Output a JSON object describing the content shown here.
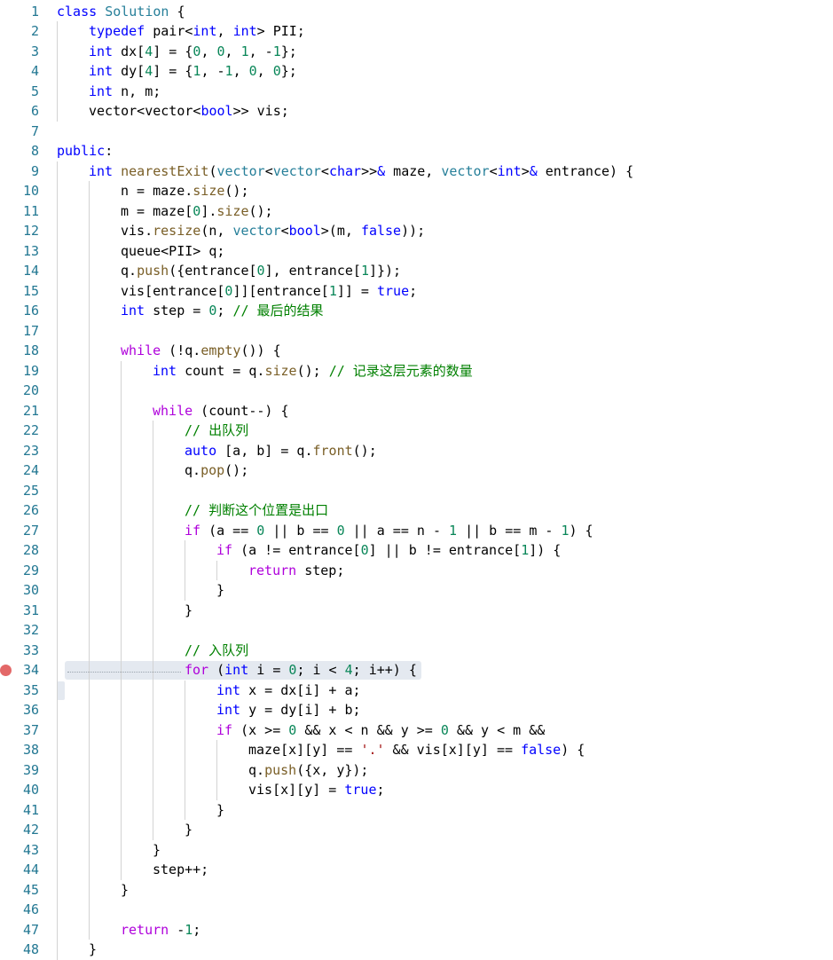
{
  "colors": {
    "keyword": "#0000ff",
    "type": "#267f99",
    "function": "#795e26",
    "control": "#af00db",
    "number": "#098658",
    "string": "#a31515",
    "comment": "#008000",
    "plain": "#000000",
    "line_number": "#237893",
    "breakpoint": "#e36868"
  },
  "editor": {
    "breakpoint_line": 34,
    "lines": [
      {
        "n": "1",
        "indent": 0,
        "tokens": [
          {
            "t": "class",
            "c": "keyword"
          },
          {
            "t": " "
          },
          {
            "t": "Solution",
            "c": "type"
          },
          {
            "t": " {"
          }
        ]
      },
      {
        "n": "2",
        "indent": 1,
        "tokens": [
          {
            "t": "typedef",
            "c": "keyword"
          },
          {
            "t": " pair<"
          },
          {
            "t": "int",
            "c": "keyword"
          },
          {
            "t": ", "
          },
          {
            "t": "int",
            "c": "keyword"
          },
          {
            "t": "> PII;"
          }
        ]
      },
      {
        "n": "3",
        "indent": 1,
        "tokens": [
          {
            "t": "int",
            "c": "keyword"
          },
          {
            "t": " dx["
          },
          {
            "t": "4",
            "c": "number"
          },
          {
            "t": "] = {"
          },
          {
            "t": "0",
            "c": "number"
          },
          {
            "t": ", "
          },
          {
            "t": "0",
            "c": "number"
          },
          {
            "t": ", "
          },
          {
            "t": "1",
            "c": "number"
          },
          {
            "t": ", -"
          },
          {
            "t": "1",
            "c": "number"
          },
          {
            "t": "};"
          }
        ]
      },
      {
        "n": "4",
        "indent": 1,
        "tokens": [
          {
            "t": "int",
            "c": "keyword"
          },
          {
            "t": " dy["
          },
          {
            "t": "4",
            "c": "number"
          },
          {
            "t": "] = {"
          },
          {
            "t": "1",
            "c": "number"
          },
          {
            "t": ", -"
          },
          {
            "t": "1",
            "c": "number"
          },
          {
            "t": ", "
          },
          {
            "t": "0",
            "c": "number"
          },
          {
            "t": ", "
          },
          {
            "t": "0",
            "c": "number"
          },
          {
            "t": "};"
          }
        ]
      },
      {
        "n": "5",
        "indent": 1,
        "tokens": [
          {
            "t": "int",
            "c": "keyword"
          },
          {
            "t": " n, m;"
          }
        ]
      },
      {
        "n": "6",
        "indent": 1,
        "tokens": [
          {
            "t": "vector<vector<"
          },
          {
            "t": "bool",
            "c": "keyword"
          },
          {
            "t": ">> vis;"
          }
        ]
      },
      {
        "n": "7",
        "indent": 0,
        "tokens": []
      },
      {
        "n": "8",
        "indent": 0,
        "tokens": [
          {
            "t": "public",
            "c": "keyword"
          },
          {
            "t": ":"
          }
        ]
      },
      {
        "n": "9",
        "indent": 1,
        "tokens": [
          {
            "t": "int",
            "c": "keyword"
          },
          {
            "t": " "
          },
          {
            "t": "nearestExit",
            "c": "function"
          },
          {
            "t": "("
          },
          {
            "t": "vector",
            "c": "type"
          },
          {
            "t": "<"
          },
          {
            "t": "vector",
            "c": "type"
          },
          {
            "t": "<"
          },
          {
            "t": "char",
            "c": "keyword"
          },
          {
            "t": ">>"
          },
          {
            "t": "&",
            "c": "keyword"
          },
          {
            "t": " maze, "
          },
          {
            "t": "vector",
            "c": "type"
          },
          {
            "t": "<"
          },
          {
            "t": "int",
            "c": "keyword"
          },
          {
            "t": ">"
          },
          {
            "t": "&",
            "c": "keyword"
          },
          {
            "t": " entrance) {"
          }
        ]
      },
      {
        "n": "10",
        "indent": 2,
        "tokens": [
          {
            "t": "n = maze."
          },
          {
            "t": "size",
            "c": "function"
          },
          {
            "t": "();"
          }
        ]
      },
      {
        "n": "11",
        "indent": 2,
        "tokens": [
          {
            "t": "m = maze["
          },
          {
            "t": "0",
            "c": "number"
          },
          {
            "t": "]."
          },
          {
            "t": "size",
            "c": "function"
          },
          {
            "t": "();"
          }
        ]
      },
      {
        "n": "12",
        "indent": 2,
        "tokens": [
          {
            "t": "vis."
          },
          {
            "t": "resize",
            "c": "function"
          },
          {
            "t": "(n, "
          },
          {
            "t": "vector",
            "c": "type"
          },
          {
            "t": "<"
          },
          {
            "t": "bool",
            "c": "keyword"
          },
          {
            "t": ">(m, "
          },
          {
            "t": "false",
            "c": "keyword"
          },
          {
            "t": "));"
          }
        ]
      },
      {
        "n": "13",
        "indent": 2,
        "tokens": [
          {
            "t": "queue<PII> q;"
          }
        ]
      },
      {
        "n": "14",
        "indent": 2,
        "tokens": [
          {
            "t": "q."
          },
          {
            "t": "push",
            "c": "function"
          },
          {
            "t": "({entrance["
          },
          {
            "t": "0",
            "c": "number"
          },
          {
            "t": "], entrance["
          },
          {
            "t": "1",
            "c": "number"
          },
          {
            "t": "]});"
          }
        ]
      },
      {
        "n": "15",
        "indent": 2,
        "tokens": [
          {
            "t": "vis[entrance["
          },
          {
            "t": "0",
            "c": "number"
          },
          {
            "t": "]][entrance["
          },
          {
            "t": "1",
            "c": "number"
          },
          {
            "t": "]] = "
          },
          {
            "t": "true",
            "c": "keyword"
          },
          {
            "t": ";"
          }
        ]
      },
      {
        "n": "16",
        "indent": 2,
        "tokens": [
          {
            "t": "int",
            "c": "keyword"
          },
          {
            "t": " step = "
          },
          {
            "t": "0",
            "c": "number"
          },
          {
            "t": "; "
          },
          {
            "t": "// 最后的结果",
            "c": "comment"
          }
        ]
      },
      {
        "n": "17",
        "indent": 0,
        "tokens": []
      },
      {
        "n": "18",
        "indent": 2,
        "tokens": [
          {
            "t": "while",
            "c": "control"
          },
          {
            "t": " (!q."
          },
          {
            "t": "empty",
            "c": "function"
          },
          {
            "t": "()) {"
          }
        ]
      },
      {
        "n": "19",
        "indent": 3,
        "tokens": [
          {
            "t": "int",
            "c": "keyword"
          },
          {
            "t": " count = q."
          },
          {
            "t": "size",
            "c": "function"
          },
          {
            "t": "(); "
          },
          {
            "t": "// 记录这层元素的数量",
            "c": "comment"
          }
        ]
      },
      {
        "n": "20",
        "indent": 0,
        "tokens": []
      },
      {
        "n": "21",
        "indent": 3,
        "tokens": [
          {
            "t": "while",
            "c": "control"
          },
          {
            "t": " (count--) {"
          }
        ]
      },
      {
        "n": "22",
        "indent": 4,
        "tokens": [
          {
            "t": "// 出队列",
            "c": "comment"
          }
        ]
      },
      {
        "n": "23",
        "indent": 4,
        "tokens": [
          {
            "t": "auto",
            "c": "keyword"
          },
          {
            "t": " [a, b] = q."
          },
          {
            "t": "front",
            "c": "function"
          },
          {
            "t": "();"
          }
        ]
      },
      {
        "n": "24",
        "indent": 4,
        "tokens": [
          {
            "t": "q."
          },
          {
            "t": "pop",
            "c": "function"
          },
          {
            "t": "();"
          }
        ]
      },
      {
        "n": "25",
        "indent": 0,
        "tokens": []
      },
      {
        "n": "26",
        "indent": 4,
        "tokens": [
          {
            "t": "// 判断这个位置是出口",
            "c": "comment"
          }
        ]
      },
      {
        "n": "27",
        "indent": 4,
        "tokens": [
          {
            "t": "if",
            "c": "control"
          },
          {
            "t": " (a == "
          },
          {
            "t": "0",
            "c": "number"
          },
          {
            "t": " || b == "
          },
          {
            "t": "0",
            "c": "number"
          },
          {
            "t": " || a == n - "
          },
          {
            "t": "1",
            "c": "number"
          },
          {
            "t": " || b == m - "
          },
          {
            "t": "1",
            "c": "number"
          },
          {
            "t": ") {"
          }
        ]
      },
      {
        "n": "28",
        "indent": 5,
        "tokens": [
          {
            "t": "if",
            "c": "control"
          },
          {
            "t": " (a != entrance["
          },
          {
            "t": "0",
            "c": "number"
          },
          {
            "t": "] || b != entrance["
          },
          {
            "t": "1",
            "c": "number"
          },
          {
            "t": "]) {"
          }
        ]
      },
      {
        "n": "29",
        "indent": 6,
        "tokens": [
          {
            "t": "return",
            "c": "control"
          },
          {
            "t": " step;"
          }
        ]
      },
      {
        "n": "30",
        "indent": 5,
        "tokens": [
          {
            "t": "}"
          }
        ]
      },
      {
        "n": "31",
        "indent": 4,
        "tokens": [
          {
            "t": "}"
          }
        ]
      },
      {
        "n": "32",
        "indent": 0,
        "tokens": []
      },
      {
        "n": "33",
        "indent": 4,
        "tokens": [
          {
            "t": "// 入队列",
            "c": "comment"
          }
        ]
      },
      {
        "n": "34",
        "indent": 4,
        "tokens": [
          {
            "t": "for",
            "c": "control"
          },
          {
            "t": " ("
          },
          {
            "t": "int",
            "c": "keyword"
          },
          {
            "t": " i = "
          },
          {
            "t": "0",
            "c": "number"
          },
          {
            "t": "; i < "
          },
          {
            "t": "4",
            "c": "number"
          },
          {
            "t": "; i++) {"
          }
        ]
      },
      {
        "n": "35",
        "indent": 5,
        "tokens": [
          {
            "t": "int",
            "c": "keyword"
          },
          {
            "t": " x = dx[i] + a;"
          }
        ]
      },
      {
        "n": "36",
        "indent": 5,
        "tokens": [
          {
            "t": "int",
            "c": "keyword"
          },
          {
            "t": " y = dy[i] + b;"
          }
        ]
      },
      {
        "n": "37",
        "indent": 5,
        "tokens": [
          {
            "t": "if",
            "c": "control"
          },
          {
            "t": " (x >= "
          },
          {
            "t": "0",
            "c": "number"
          },
          {
            "t": " && x < n && y >= "
          },
          {
            "t": "0",
            "c": "number"
          },
          {
            "t": " && y < m &&"
          }
        ]
      },
      {
        "n": "38",
        "indent": 6,
        "tokens": [
          {
            "t": "maze[x][y] == "
          },
          {
            "t": "'.'",
            "c": "string"
          },
          {
            "t": " && vis[x][y] == "
          },
          {
            "t": "false",
            "c": "keyword"
          },
          {
            "t": ") {"
          }
        ]
      },
      {
        "n": "39",
        "indent": 6,
        "tokens": [
          {
            "t": "q."
          },
          {
            "t": "push",
            "c": "function"
          },
          {
            "t": "({x, y});"
          }
        ]
      },
      {
        "n": "40",
        "indent": 6,
        "tokens": [
          {
            "t": "vis[x][y] = "
          },
          {
            "t": "true",
            "c": "keyword"
          },
          {
            "t": ";"
          }
        ]
      },
      {
        "n": "41",
        "indent": 5,
        "tokens": [
          {
            "t": "}"
          }
        ]
      },
      {
        "n": "42",
        "indent": 4,
        "tokens": [
          {
            "t": "}"
          }
        ]
      },
      {
        "n": "43",
        "indent": 3,
        "tokens": [
          {
            "t": "}"
          }
        ]
      },
      {
        "n": "44",
        "indent": 3,
        "tokens": [
          {
            "t": "step++;"
          }
        ]
      },
      {
        "n": "45",
        "indent": 2,
        "tokens": [
          {
            "t": "}"
          }
        ]
      },
      {
        "n": "46",
        "indent": 0,
        "tokens": []
      },
      {
        "n": "47",
        "indent": 2,
        "tokens": [
          {
            "t": "return",
            "c": "control"
          },
          {
            "t": " -"
          },
          {
            "t": "1",
            "c": "number"
          },
          {
            "t": ";"
          }
        ]
      },
      {
        "n": "48",
        "indent": 1,
        "tokens": [
          {
            "t": "}"
          }
        ]
      }
    ]
  }
}
